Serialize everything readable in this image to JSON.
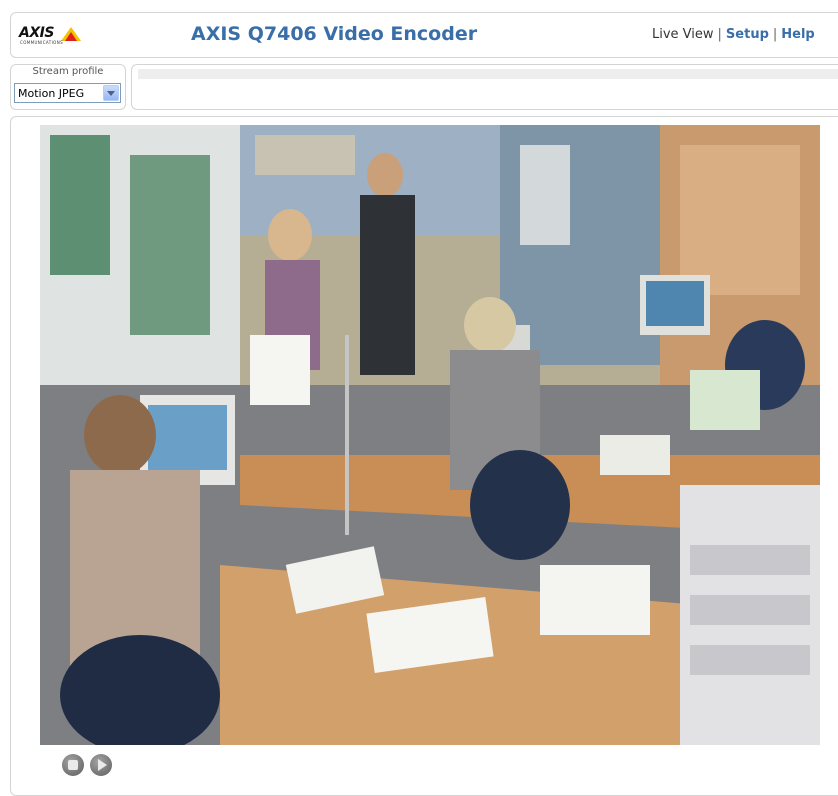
{
  "header": {
    "logo_text": "AXIS",
    "logo_subtext": "COMMUNICATIONS",
    "title": "AXIS Q7406 Video Encoder",
    "nav": {
      "live_view": "Live View",
      "setup": "Setup",
      "help": "Help",
      "separator": "|"
    }
  },
  "stream_profile": {
    "label": "Stream profile",
    "selected": "Motion JPEG"
  },
  "video": {
    "description_icon": "live-video-feed"
  },
  "controls": {
    "stop_icon": "stop-icon",
    "play_icon": "play-icon"
  },
  "colors": {
    "accent": "#3a6ea8",
    "panel_border": "#d4d4d4",
    "logo_yellow": "#f4c400"
  }
}
